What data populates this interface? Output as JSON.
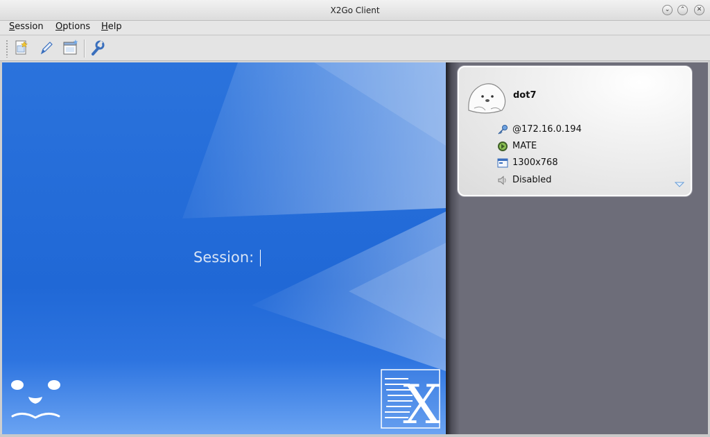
{
  "window": {
    "title": "X2Go Client",
    "controls": {
      "minimize": "⌄",
      "maximize": "⌃",
      "close": "✕"
    }
  },
  "menu": {
    "items": [
      {
        "label": "Session"
      },
      {
        "label": "Options"
      },
      {
        "label": "Help"
      }
    ]
  },
  "toolbar": {
    "buttons": [
      {
        "icon": "new-session-icon"
      },
      {
        "icon": "edit-session-icon"
      },
      {
        "icon": "session-window-icon"
      },
      {
        "icon": "preferences-wrench-icon"
      }
    ]
  },
  "login": {
    "session_label": "Session:",
    "session_value": ""
  },
  "session_card": {
    "name": "dot7",
    "server": "@172.16.0.194",
    "desktop": "MATE",
    "resolution": "1300x768",
    "sound": "Disabled",
    "icons": [
      "key-icon",
      "mate-logo-icon",
      "display-icon",
      "speaker-icon",
      "seal-avatar-icon",
      "expand-arrow-icon"
    ]
  },
  "colors": {
    "left_bg": "#2068d6",
    "right_bg": "#6d6d79",
    "card_bg": "#f2f2f2"
  }
}
